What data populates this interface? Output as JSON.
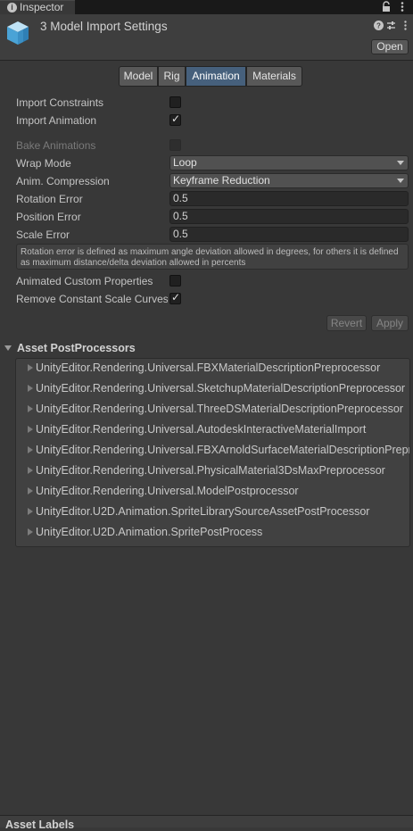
{
  "window": {
    "tab_label": "Inspector"
  },
  "header": {
    "title": "3 Model Import Settings",
    "open_label": "Open"
  },
  "tabs": [
    {
      "label": "Model",
      "active": false
    },
    {
      "label": "Rig",
      "active": false
    },
    {
      "label": "Animation",
      "active": true
    },
    {
      "label": "Materials",
      "active": false
    }
  ],
  "settings": {
    "import_constraints": {
      "label": "Import Constraints",
      "checked": false
    },
    "import_animation": {
      "label": "Import Animation",
      "checked": true
    },
    "bake_animations": {
      "label": "Bake Animations",
      "checked": false,
      "disabled": true
    },
    "wrap_mode": {
      "label": "Wrap Mode",
      "value": "Loop"
    },
    "anim_compression": {
      "label": "Anim. Compression",
      "value": "Keyframe Reduction"
    },
    "rotation_error": {
      "label": "Rotation Error",
      "value": "0.5"
    },
    "position_error": {
      "label": "Position Error",
      "value": "0.5"
    },
    "scale_error": {
      "label": "Scale Error",
      "value": "0.5"
    },
    "help_text": "Rotation error is defined as maximum angle deviation allowed in degrees, for others it is defined as maximum distance/delta deviation allowed in percents",
    "animated_custom_properties": {
      "label": "Animated Custom Properties",
      "checked": false
    },
    "remove_constant_scale_curves": {
      "label": "Remove Constant Scale Curves",
      "checked": true
    }
  },
  "actions": {
    "revert_label": "Revert",
    "apply_label": "Apply"
  },
  "postprocessors": {
    "title": "Asset PostProcessors",
    "items": [
      "UnityEditor.Rendering.Universal.FBXMaterialDescriptionPreprocessor",
      "UnityEditor.Rendering.Universal.SketchupMaterialDescriptionPreprocessor",
      "UnityEditor.Rendering.Universal.ThreeDSMaterialDescriptionPreprocessor",
      "UnityEditor.Rendering.Universal.AutodeskInteractiveMaterialImport",
      "UnityEditor.Rendering.Universal.FBXArnoldSurfaceMaterialDescriptionPreprocessor",
      "UnityEditor.Rendering.Universal.PhysicalMaterial3DsMaxPreprocessor",
      "UnityEditor.Rendering.Universal.ModelPostprocessor",
      "UnityEditor.U2D.Animation.SpriteLibrarySourceAssetPostProcessor",
      "UnityEditor.U2D.Animation.SpritePostProcess"
    ]
  },
  "footer": {
    "title": "Asset Labels"
  },
  "colors": {
    "background": "#383838",
    "active_tab": "#46607c",
    "text": "#c4c4c4"
  }
}
